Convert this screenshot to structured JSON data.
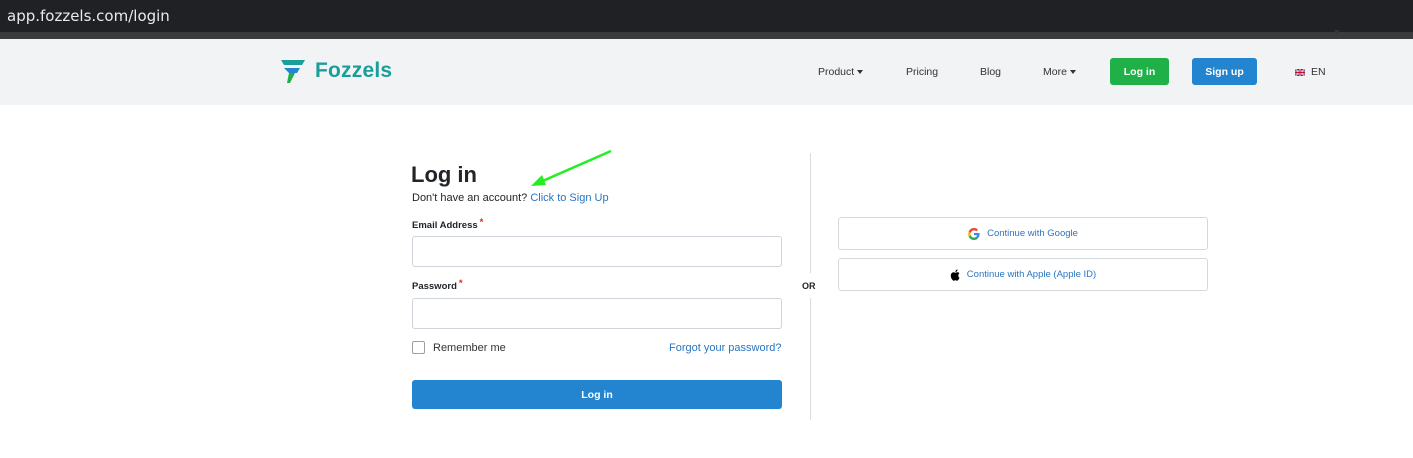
{
  "browser": {
    "url": "app.fozzels.com/login"
  },
  "brand": {
    "name": "Fozzels",
    "color": "#1a9e9a",
    "logo_icon": "fozzels-logo-icon"
  },
  "nav": {
    "product": "Product",
    "pricing": "Pricing",
    "blog": "Blog",
    "more": "More",
    "login": "Log in",
    "signup": "Sign up",
    "lang": "EN"
  },
  "form": {
    "title": "Log in",
    "no_account": "Don't have an account?",
    "signup_link": "Click to Sign Up",
    "email_label": "Email Address",
    "email_value": "",
    "password_label": "Password",
    "password_value": "",
    "required_mark": "*",
    "remember": "Remember me",
    "forgot": "Forgot your password?",
    "submit": "Log in"
  },
  "separator": "OR",
  "social": {
    "google": "Continue with Google",
    "apple": "Continue with Apple (Apple ID)"
  },
  "colors": {
    "login_green": "#1fb148",
    "primary_blue": "#2384d0",
    "link_blue": "#2a75c2",
    "annotation_arrow": "#22ee22"
  }
}
